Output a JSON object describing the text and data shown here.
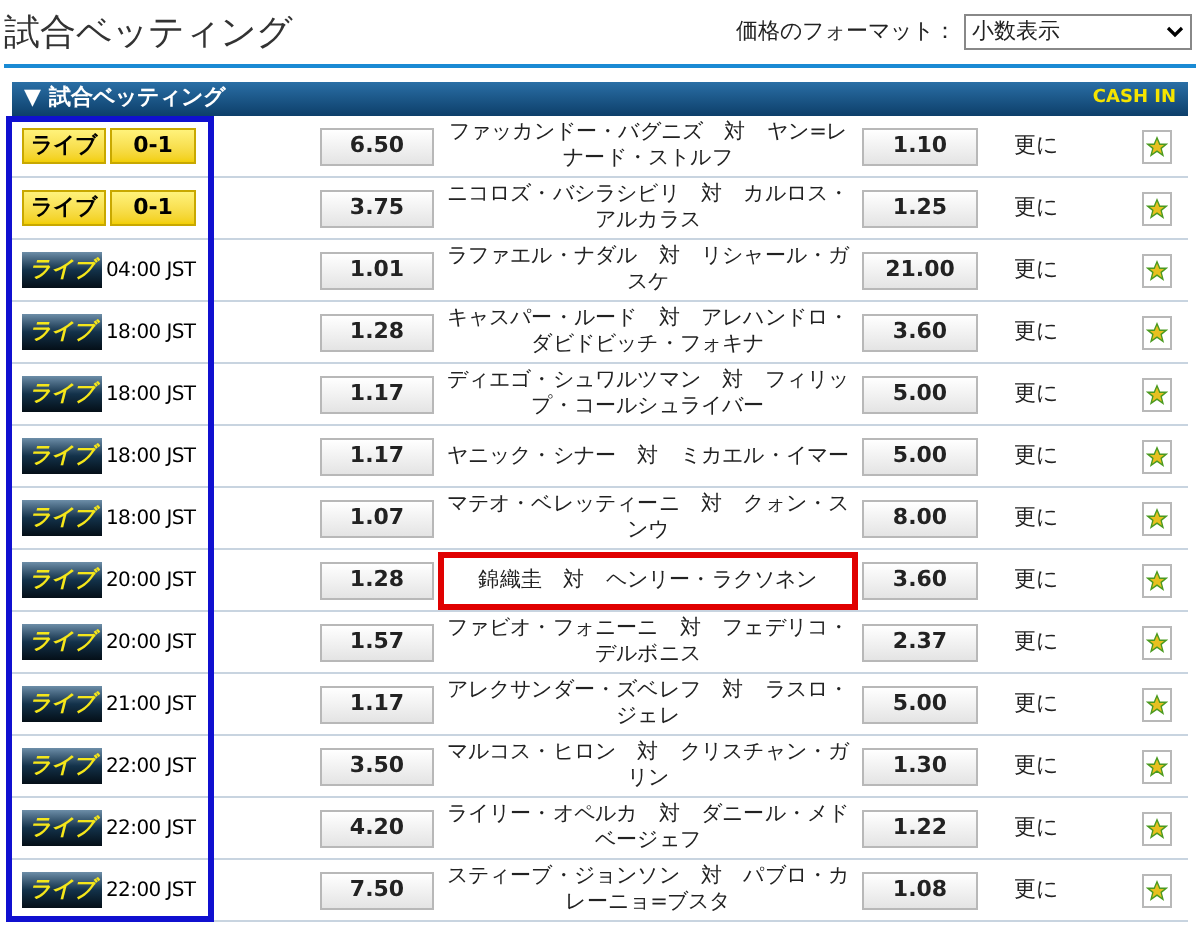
{
  "title": "試合ベッティング",
  "price_format": {
    "label": "価格のフォーマット：",
    "value": "小数表示"
  },
  "section": {
    "toggle": "▼",
    "title": "試合ベッティング",
    "cash_in": "CASH IN"
  },
  "rows": [
    {
      "kind": "in_play",
      "badge": "ライブ",
      "status": "0-1",
      "odds_1": "6.50",
      "match": "ファッカンドー・バグニズ　対　ヤン=レナード・ストルフ",
      "odds_2": "1.10",
      "more": "更に",
      "highlighted": false
    },
    {
      "kind": "in_play",
      "badge": "ライブ",
      "status": "0-1",
      "odds_1": "3.75",
      "match": "ニコロズ・バシラシビリ　対　カルロス・アルカラス",
      "odds_2": "1.25",
      "more": "更に",
      "highlighted": false
    },
    {
      "kind": "upcoming",
      "badge": "ライブ",
      "status": "04:00 JST",
      "odds_1": "1.01",
      "match": "ラファエル・ナダル　対　リシャール・ガスケ",
      "odds_2": "21.00",
      "more": "更に",
      "highlighted": false
    },
    {
      "kind": "upcoming",
      "badge": "ライブ",
      "status": "18:00 JST",
      "odds_1": "1.28",
      "match": "キャスパー・ルード　対　アレハンドロ・ダビドビッチ・フォキナ",
      "odds_2": "3.60",
      "more": "更に",
      "highlighted": false
    },
    {
      "kind": "upcoming",
      "badge": "ライブ",
      "status": "18:00 JST",
      "odds_1": "1.17",
      "match": "ディエゴ・シュワルツマン　対　フィリップ・コールシュライバー",
      "odds_2": "5.00",
      "more": "更に",
      "highlighted": false
    },
    {
      "kind": "upcoming",
      "badge": "ライブ",
      "status": "18:00 JST",
      "odds_1": "1.17",
      "match": "ヤニック・シナー　対　ミカエル・イマー",
      "odds_2": "5.00",
      "more": "更に",
      "highlighted": false
    },
    {
      "kind": "upcoming",
      "badge": "ライブ",
      "status": "18:00 JST",
      "odds_1": "1.07",
      "match": "マテオ・ベレッティーニ　対　クォン・スンウ",
      "odds_2": "8.00",
      "more": "更に",
      "highlighted": false
    },
    {
      "kind": "upcoming",
      "badge": "ライブ",
      "status": "20:00 JST",
      "odds_1": "1.28",
      "match": "錦織圭　対　ヘンリー・ラクソネン",
      "odds_2": "3.60",
      "more": "更に",
      "highlighted": true
    },
    {
      "kind": "upcoming",
      "badge": "ライブ",
      "status": "20:00 JST",
      "odds_1": "1.57",
      "match": "ファビオ・フォニーニ　対　フェデリコ・デルボニス",
      "odds_2": "2.37",
      "more": "更に",
      "highlighted": false
    },
    {
      "kind": "upcoming",
      "badge": "ライブ",
      "status": "21:00 JST",
      "odds_1": "1.17",
      "match": "アレクサンダー・ズベレフ　対　ラスロ・ジェレ",
      "odds_2": "5.00",
      "more": "更に",
      "highlighted": false
    },
    {
      "kind": "upcoming",
      "badge": "ライブ",
      "status": "22:00 JST",
      "odds_1": "3.50",
      "match": "マルコス・ヒロン　対　クリスチャン・ガリン",
      "odds_2": "1.30",
      "more": "更に",
      "highlighted": false
    },
    {
      "kind": "upcoming",
      "badge": "ライブ",
      "status": "22:00 JST",
      "odds_1": "4.20",
      "match": "ライリー・オペルカ　対　ダニール・メドベージェフ",
      "odds_2": "1.22",
      "more": "更に",
      "highlighted": false
    },
    {
      "kind": "upcoming",
      "badge": "ライブ",
      "status": "22:00 JST",
      "odds_1": "7.50",
      "match": "スティーブ・ジョンソン　対　パブロ・カレーニョ=ブスタ",
      "odds_2": "1.08",
      "more": "更に",
      "highlighted": false
    }
  ]
}
